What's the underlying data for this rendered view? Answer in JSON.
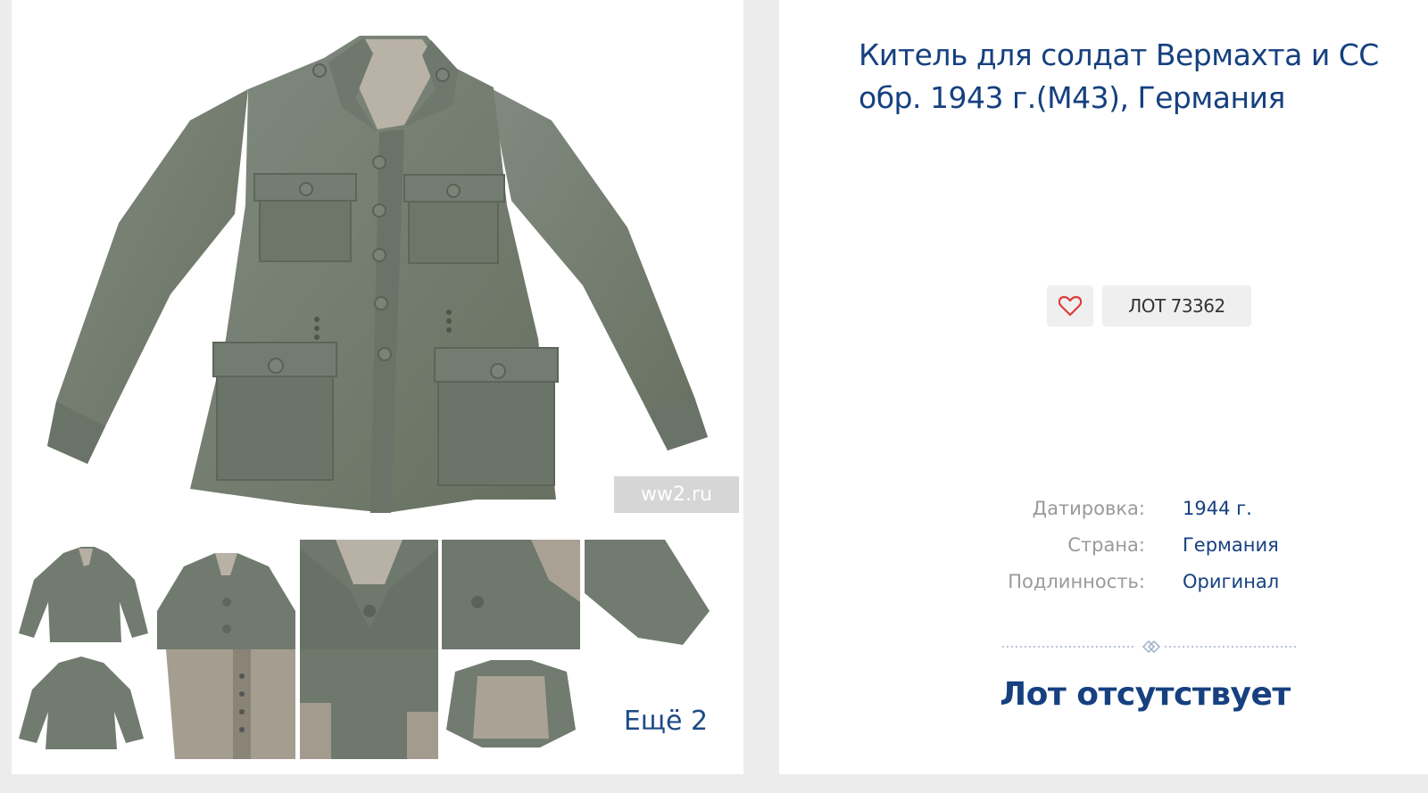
{
  "product": {
    "title": "Китель для солдат Вермахта и СС обр. 1943 г.(М43), Германия",
    "watermark": "ww2.ru",
    "lot_label": "ЛОТ 73362",
    "more_photos_label": "Ещё 2",
    "status": "Лот отсутствует",
    "properties": [
      {
        "label": "Датировка:",
        "value": "1944 г."
      },
      {
        "label": "Страна:",
        "value": "Германия"
      },
      {
        "label": "Подлинность:",
        "value": "Оригинал"
      }
    ],
    "thumbnails": [
      "jacket-front",
      "jacket-upper",
      "collar-closeup",
      "shoulder-closeup",
      "sleeve-closeup",
      "jacket-back",
      "lining-stamps",
      "fabric-detail",
      "jacket-lining-open"
    ]
  },
  "colors": {
    "accent": "#16407f",
    "cloth": "#737c72",
    "badge_bg": "#efefef",
    "heart": "#e03a3a",
    "page_bg": "#ececec"
  }
}
